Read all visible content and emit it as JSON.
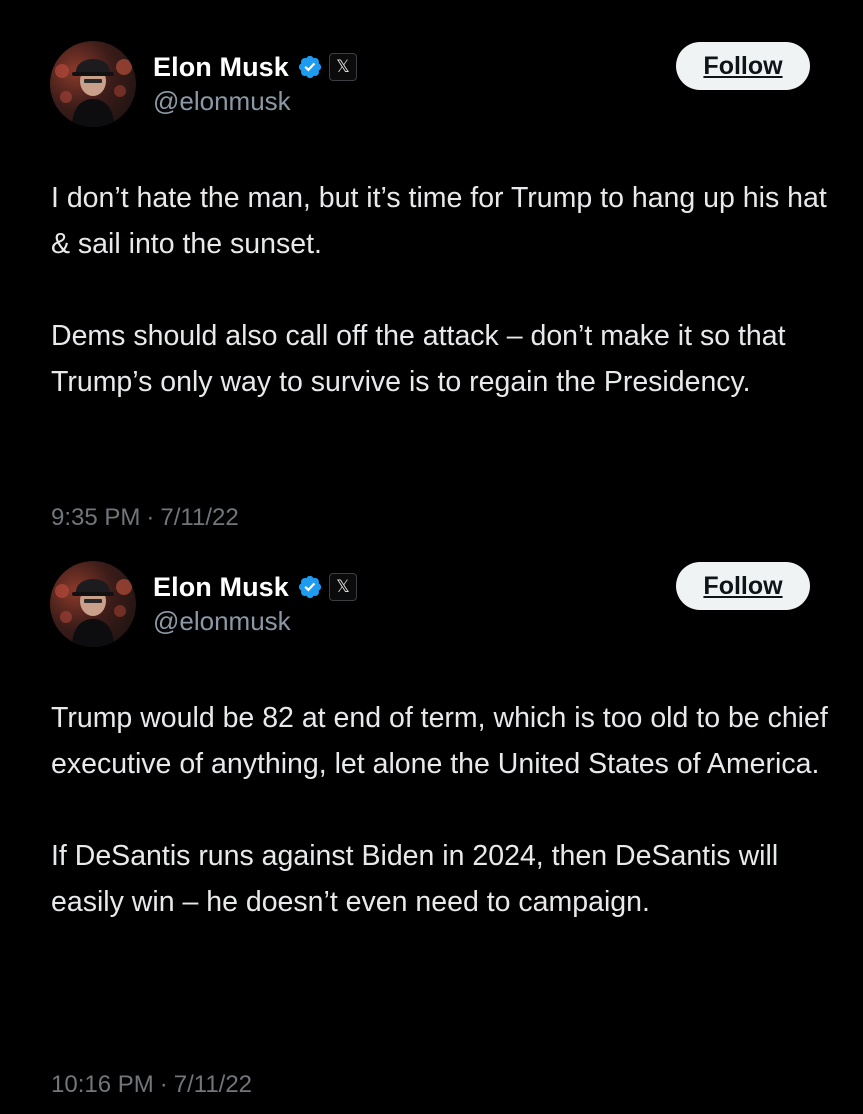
{
  "colors": {
    "background": "#000000",
    "text": "#e7e9ea",
    "secondary": "#8b98a5",
    "timestamp": "#71767b",
    "verified": "#1d9bf0",
    "follow_bg": "#eff3f4"
  },
  "tweets": [
    {
      "author": {
        "name": "Elon Musk",
        "handle": "@elonmusk",
        "verified_icon": "verified-badge-icon",
        "affiliation_icon": "x-logo-icon",
        "affiliation_glyph": "𝕏"
      },
      "follow_label": "Follow",
      "paragraphs": [
        "I don’t hate the man, but it’s time for Trump to hang up his hat & sail into the sunset.",
        "Dems should also call off the attack – don’t make it so that Trump’s only way to survive is to regain the Presidency."
      ],
      "time": "9:35 PM",
      "separator": "·",
      "date": "7/11/22"
    },
    {
      "author": {
        "name": "Elon Musk",
        "handle": "@elonmusk",
        "verified_icon": "verified-badge-icon",
        "affiliation_icon": "x-logo-icon",
        "affiliation_glyph": "𝕏"
      },
      "follow_label": "Follow",
      "paragraphs": [
        "Trump would be 82 at end of term, which is too old to be chief executive of anything, let alone the United States of America.",
        "If DeSantis runs against Biden in 2024, then DeSantis will easily win – he doesn’t even need to campaign."
      ],
      "time": "10:16 PM",
      "separator": "·",
      "date": "7/11/22"
    }
  ]
}
